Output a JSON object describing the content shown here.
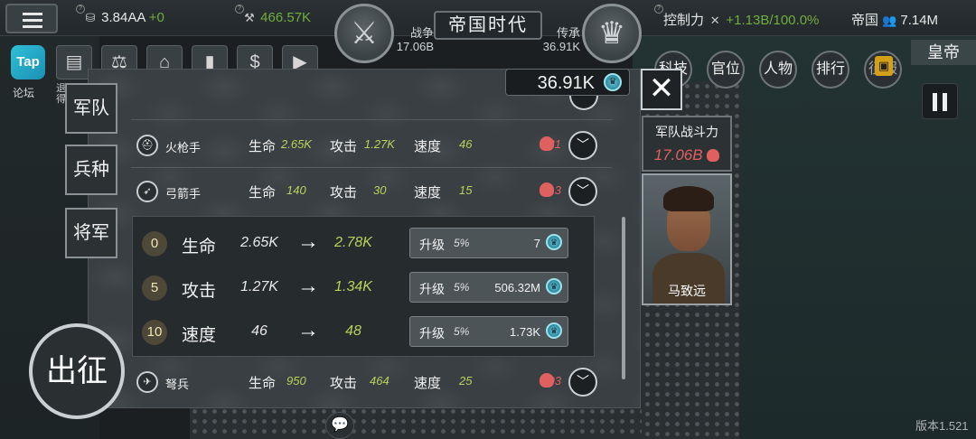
{
  "topbar": {
    "food": "3.84AA",
    "food_change": "+0",
    "wood": "466.57K",
    "war_label": "战争",
    "war_value": "17.06B",
    "title": "帝国时代",
    "heritage_label": "传承",
    "heritage_value": "36.91K",
    "control_label": "控制力",
    "control_value": "+1.13B",
    "control_percent": "/100.0%",
    "empire_label": "帝国",
    "empire_value": "7.14M"
  },
  "apps": {
    "tap_label": "Tap",
    "forum_label": "论坛",
    "partial_label": "退",
    "partial_label2": "得"
  },
  "nav_tabs": [
    "科技",
    "官位",
    "人物",
    "排行",
    "征服"
  ],
  "emperor": "皇帝",
  "side_tabs": [
    "军队",
    "兵种",
    "将军"
  ],
  "currency": {
    "value": "36.91K"
  },
  "units": [
    {
      "name": "火枪手",
      "hp_label": "生命",
      "hp": "2.65K",
      "atk_label": "攻击",
      "atk": "1.27K",
      "spd_label": "速度",
      "spd": "46",
      "kills": "281",
      "icon": "helmet-icon"
    },
    {
      "name": "弓箭手",
      "hp_label": "生命",
      "hp": "140",
      "atk_label": "攻击",
      "atk": "30",
      "spd_label": "速度",
      "spd": "15",
      "kills": "13",
      "icon": "bow-icon"
    },
    {
      "name": "弩兵",
      "hp_label": "生命",
      "hp": "950",
      "atk_label": "攻击",
      "atk": "464",
      "spd_label": "速度",
      "spd": "25",
      "kills": "103",
      "icon": "crossbow-icon"
    }
  ],
  "upgrades": [
    {
      "level": "0",
      "label": "生命",
      "from": "2.65K",
      "to": "2.78K",
      "btn_label": "升级",
      "pct": "5%",
      "cost": "7"
    },
    {
      "level": "5",
      "label": "攻击",
      "from": "1.27K",
      "to": "1.34K",
      "btn_label": "升级",
      "pct": "5%",
      "cost": "506.32M"
    },
    {
      "level": "10",
      "label": "速度",
      "from": "46",
      "to": "48",
      "btn_label": "升级",
      "pct": "5%",
      "cost": "1.73K"
    }
  ],
  "army_power": {
    "label": "军队战斗力",
    "value": "17.06B"
  },
  "general": {
    "name": "马致远"
  },
  "expedition": "出征",
  "version": "版本1.521",
  "colors": {
    "green": "#6fae3c",
    "kill_red": "#e06060",
    "stat_yellow": "#b8d15a",
    "crown_teal": "#2b8aa0"
  }
}
